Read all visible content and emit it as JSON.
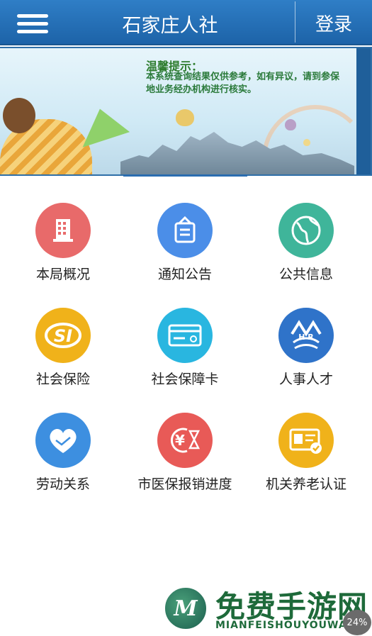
{
  "header": {
    "title": "石家庄人社",
    "login_label": "登录"
  },
  "banner": {
    "tip_title": "温馨提示：",
    "tip_text": "本系统查询结果仅供参考，如有异议，请到参保地业务经办机构进行核实。"
  },
  "menu": [
    {
      "label": "本局概况",
      "icon": "building-icon",
      "color": "#e86a6a"
    },
    {
      "label": "通知公告",
      "icon": "notice-board-icon",
      "color": "#4b8ee8"
    },
    {
      "label": "公共信息",
      "icon": "globe-icon",
      "color": "#3fb59a"
    },
    {
      "label": "社会保险",
      "icon": "si-logo-icon",
      "color": "#f0b21a"
    },
    {
      "label": "社会保障卡",
      "icon": "card-icon",
      "color": "#29b6e0"
    },
    {
      "label": "人事人才",
      "icon": "hr-logo-icon",
      "color": "#2f73c9"
    },
    {
      "label": "劳动关系",
      "icon": "handshake-heart-icon",
      "color": "#3d8fe0"
    },
    {
      "label": "市医保报销进度",
      "icon": "yen-hourglass-icon",
      "color": "#e85a57"
    },
    {
      "label": "机关养老认证",
      "icon": "id-card-check-icon",
      "color": "#f0b21a"
    }
  ],
  "watermark": {
    "logo_letter": "M",
    "text": "免费手游网",
    "sub": "MIANFEISHOUYOUWANG"
  },
  "badge": "24%"
}
